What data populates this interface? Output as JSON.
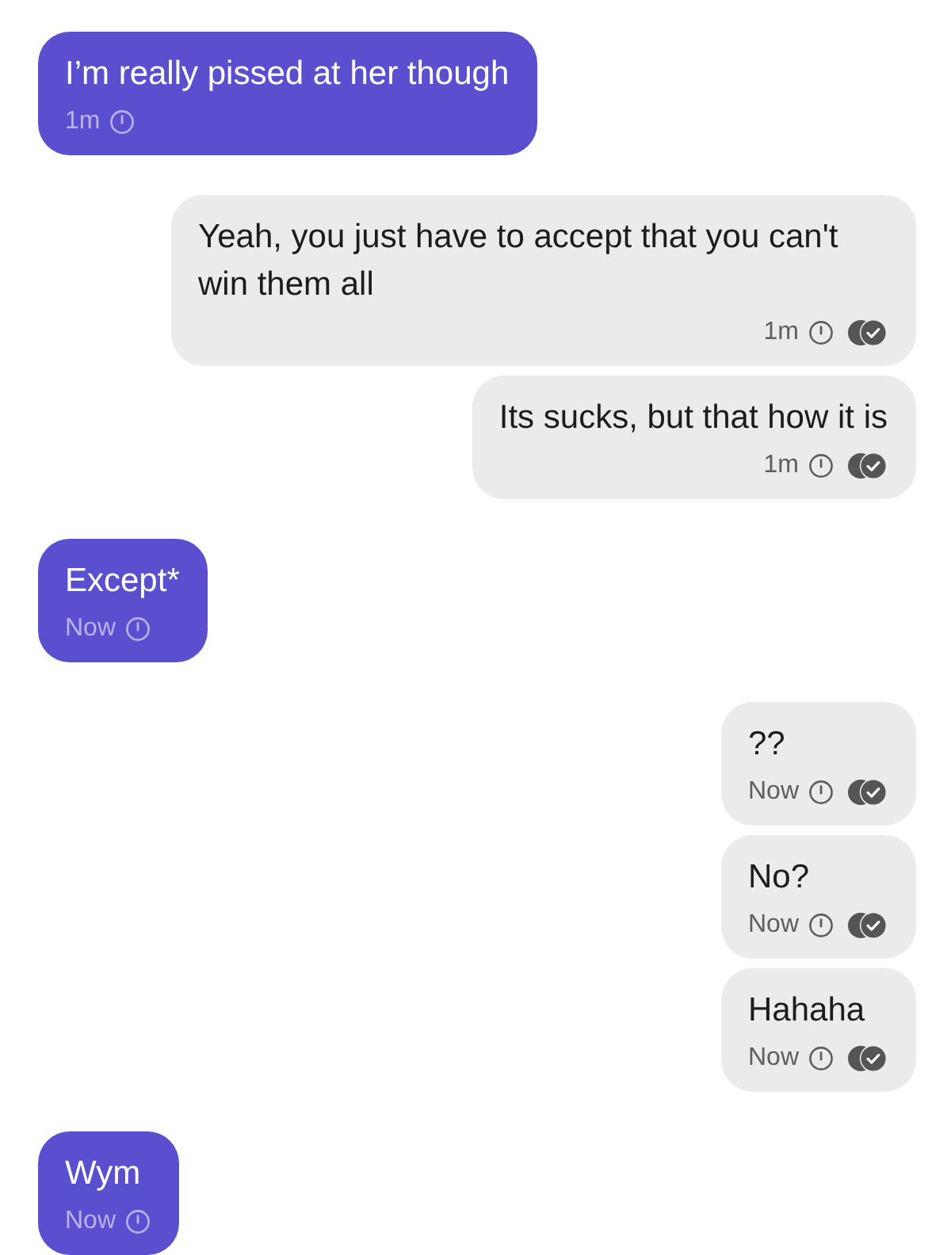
{
  "messages": [
    {
      "kind": "received",
      "text": "I’m really pissed at her though",
      "time": "1m"
    },
    {
      "kind": "sent",
      "text": "Yeah, you just have to accept that you can't win them all",
      "time": "1m",
      "read": true
    },
    {
      "kind": "sent",
      "text": "Its sucks, but that how it is",
      "time": "1m",
      "read": true
    },
    {
      "kind": "received",
      "text": "Except*",
      "time": "Now"
    },
    {
      "kind": "sent",
      "text": "??",
      "time": "Now",
      "read": true
    },
    {
      "kind": "sent",
      "text": "No?",
      "time": "Now",
      "read": true
    },
    {
      "kind": "sent",
      "text": "Hahaha",
      "time": "Now",
      "read": true
    },
    {
      "kind": "received",
      "text": "Wym",
      "time": "Now"
    }
  ]
}
